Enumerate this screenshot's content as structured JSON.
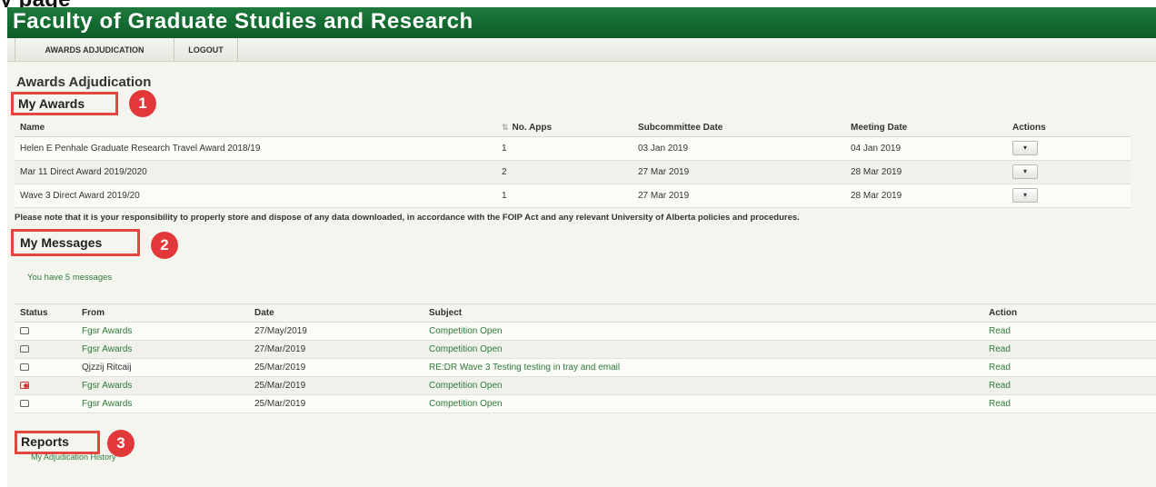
{
  "app": {
    "title": "Faculty of Graduate Studies and Research",
    "title_clipped": "y                                                   page"
  },
  "nav": {
    "items": [
      {
        "label": "AWARDS ADJUDICATION"
      },
      {
        "label": "LOGOUT"
      }
    ]
  },
  "page": {
    "title": "Awards Adjudication"
  },
  "my_awards": {
    "heading": "My Awards",
    "badge": "1",
    "columns": [
      "Name",
      "No. Apps",
      "Subcommittee Date",
      "Meeting Date",
      "Actions"
    ],
    "rows": [
      {
        "name": "Helen E Penhale Graduate Research Travel Award 2018/19",
        "apps": "1",
        "subcommittee": "03 Jan 2019",
        "meeting": "04 Jan 2019",
        "action": "▾"
      },
      {
        "name": "Mar 11 Direct Award 2019/2020",
        "apps": "2",
        "subcommittee": "27 Mar 2019",
        "meeting": "28 Mar 2019",
        "action": "▾"
      },
      {
        "name": "Wave 3 Direct Award 2019/20",
        "apps": "1",
        "subcommittee": "27 Mar 2019",
        "meeting": "28 Mar 2019",
        "action": "▾"
      }
    ]
  },
  "notice": "Please note that it is your responsibility to properly store and dispose of any data downloaded, in accordance with the FOIP Act and any relevant University of Alberta policies and procedures.",
  "my_messages": {
    "heading": "My Messages",
    "badge": "2",
    "count_text": "You have 5 messages",
    "columns": [
      "Status",
      "From",
      "Date",
      "Subject",
      "Action"
    ],
    "rows": [
      {
        "status": "read-envelope-icon",
        "from": "Fgsr Awards",
        "date": "27/May/2019",
        "subject": "Competition Open",
        "action": "Read"
      },
      {
        "status": "read-envelope-icon",
        "from": "Fgsr Awards",
        "date": "27/Mar/2019",
        "subject": "Competition Open",
        "action": "Read"
      },
      {
        "status": "read-envelope-icon",
        "from": "Qjzzij Ritcaij",
        "date": "25/Mar/2019",
        "subject": "RE:DR Wave 3 Testing testing in tray and email",
        "action": "Read"
      },
      {
        "status": "flagged-envelope-icon",
        "from": "Fgsr Awards",
        "date": "25/Mar/2019",
        "subject": "Competition Open",
        "action": "Read"
      },
      {
        "status": "read-envelope-icon",
        "from": "Fgsr Awards",
        "date": "25/Mar/2019",
        "subject": "Competition Open",
        "action": "Read"
      }
    ]
  },
  "reports": {
    "heading": "Reports",
    "badge": "3",
    "link": "My Adjudication History"
  },
  "colors": {
    "banner_green": "#126a30",
    "link_green": "#2d7a3a",
    "highlight_red": "#e2463f"
  }
}
